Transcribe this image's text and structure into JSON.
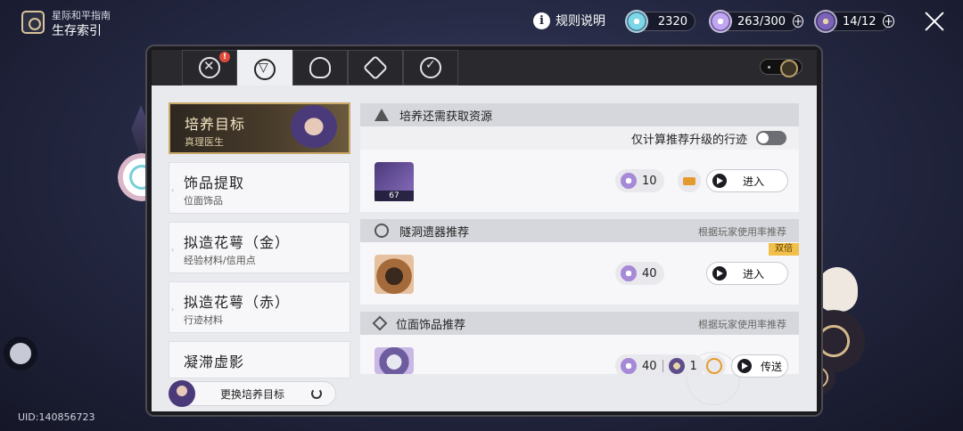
{
  "header": {
    "subtitle": "星际和平指南",
    "title": "生存索引"
  },
  "top_right": {
    "info_label": "规则说明",
    "resources": [
      {
        "name": "stellar-jade",
        "value": "2320"
      },
      {
        "name": "trailblaze-power",
        "value": "263/300"
      },
      {
        "name": "reserved-power",
        "value": "14/12"
      }
    ],
    "plus": "+"
  },
  "tabs": {
    "badge": "!"
  },
  "categories": [
    {
      "title": "培养目标",
      "subtitle": "真理医生"
    },
    {
      "title": "饰品提取",
      "subtitle": "位面饰品"
    },
    {
      "title": "拟造花萼（金）",
      "subtitle": "经验材料/信用点"
    },
    {
      "title": "拟造花萼（赤）",
      "subtitle": "行迹材料"
    },
    {
      "title": "凝滞虚影",
      "subtitle": ""
    }
  ],
  "switch_target_label": "更换培养目标",
  "sections": {
    "resources_needed": {
      "title": "培养还需获取资源",
      "filter_label": "仅计算推荐升级的行迹",
      "item_count": "67",
      "cost": "10",
      "enter_label": "进入"
    },
    "cavern": {
      "title": "隧洞遗器推荐",
      "note": "根据玩家使用率推荐",
      "double_label": "双倍",
      "cost": "40",
      "enter_label": "进入"
    },
    "planar": {
      "title": "位面饰品推荐",
      "note": "根据玩家使用率推荐",
      "cost": "40",
      "pass_cost": "1",
      "teleport_label": "传送"
    }
  },
  "uid": "UID:140856723"
}
